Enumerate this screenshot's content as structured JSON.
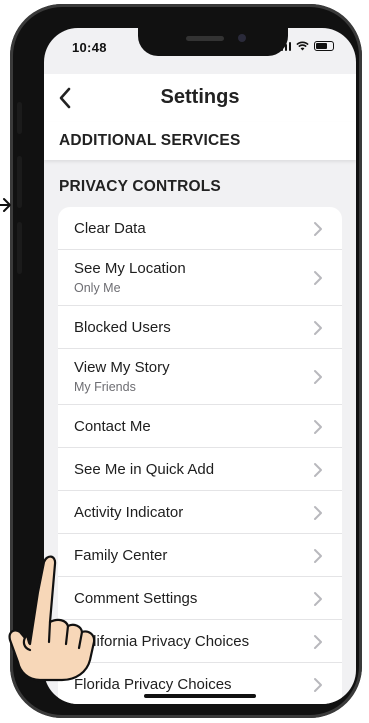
{
  "status_bar": {
    "time": "10:48"
  },
  "header": {
    "title": "Settings"
  },
  "sections": {
    "additional": "ADDITIONAL SERVICES",
    "privacy": "PRIVACY CONTROLS"
  },
  "privacy_items": [
    {
      "label": "Clear Data",
      "sub": ""
    },
    {
      "label": "See My Location",
      "sub": "Only Me"
    },
    {
      "label": "Blocked Users",
      "sub": ""
    },
    {
      "label": "View My Story",
      "sub": "My Friends"
    },
    {
      "label": "Contact Me",
      "sub": ""
    },
    {
      "label": "See Me in Quick Add",
      "sub": ""
    },
    {
      "label": "Activity Indicator",
      "sub": ""
    },
    {
      "label": "Family Center",
      "sub": ""
    },
    {
      "label": "Comment Settings",
      "sub": ""
    },
    {
      "label": "California Privacy Choices",
      "sub": ""
    },
    {
      "label": "Florida Privacy Choices",
      "sub": ""
    }
  ],
  "colors": {
    "background": "#f1f1f3",
    "card": "#ffffff",
    "text": "#1e1e1e",
    "subtext": "#6d6d72",
    "chevron": "#b8b8bd"
  }
}
